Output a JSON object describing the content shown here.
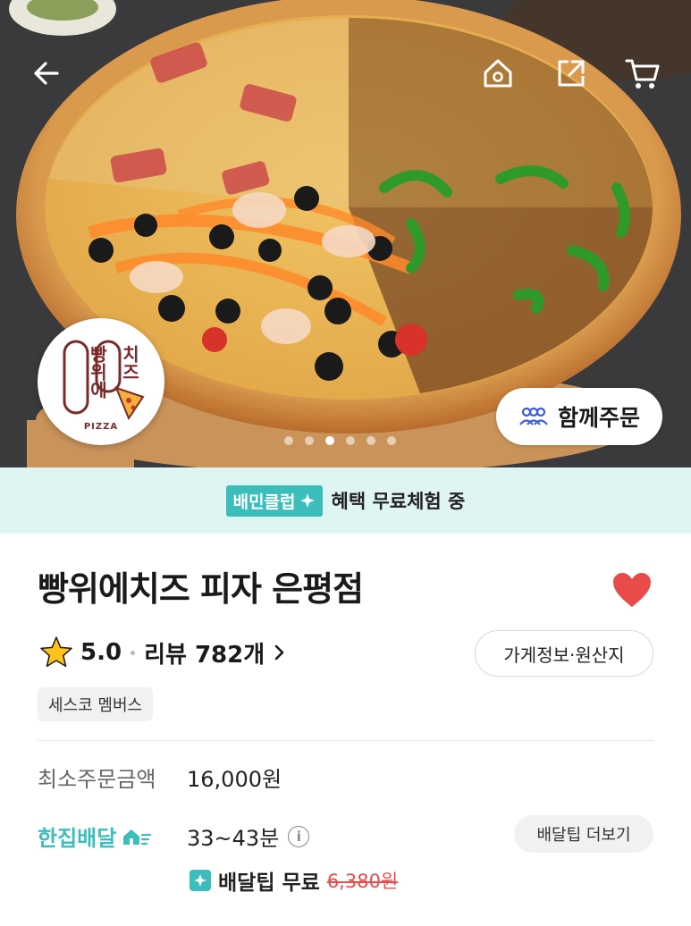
{
  "header": {
    "back_icon": "arrow-left-icon",
    "home_icon": "home-icon",
    "share_icon": "share-icon",
    "cart_icon": "cart-icon"
  },
  "hero": {
    "logo_text_1": "빵위에",
    "logo_text_2": "치즈",
    "logo_sub": "PIZZA",
    "together_order_label": "함께주문",
    "carousel": {
      "total": 6,
      "active_index": 2
    }
  },
  "club_bar": {
    "badge": "배민클럽",
    "text": "혜택 무료체험 중"
  },
  "store": {
    "name": "빵위에치즈 피자 은평점",
    "favorited": true,
    "rating": "5.0",
    "review_label": "리뷰 782개",
    "store_info_button": "가게정보·원산지",
    "tag": "세스코 멤버스"
  },
  "order_info": {
    "min_order_label": "최소주문금액",
    "min_order_value": "16,000원",
    "delivery_label": "한집배달",
    "delivery_time": "33~43분",
    "tip_more_button": "배달팁 더보기",
    "free_tip_label": "배달팁 무료",
    "original_tip": "6,380원"
  },
  "colors": {
    "accent_mint": "#3bbdbb",
    "heart_red": "#e94a4a",
    "club_bg": "#dff5f4"
  }
}
